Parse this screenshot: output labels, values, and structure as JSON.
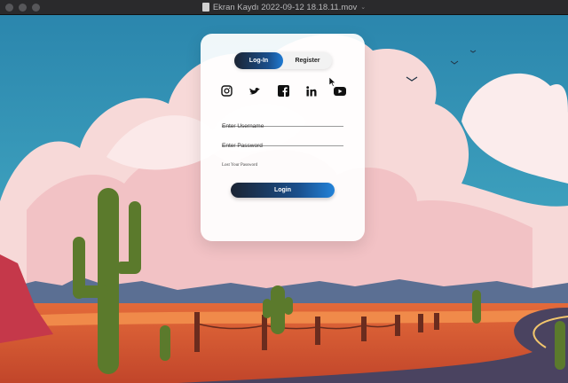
{
  "window": {
    "title": "Ekran Kaydı 2022-09-12 18.18.11.mov"
  },
  "form": {
    "tabs": [
      {
        "label": "Log-In",
        "active": true
      },
      {
        "label": "Register",
        "active": false
      }
    ],
    "social_icons": [
      "instagram-icon",
      "twitter-icon",
      "facebook-icon",
      "linkedin-icon",
      "youtube-icon"
    ],
    "username_placeholder": "Enter Username",
    "password_placeholder": "Enter Password",
    "lost_password": "Lost Your Password",
    "login_button": "Login"
  },
  "colors": {
    "button_gradient_start": "#1b2433",
    "button_gradient_end": "#2383d9",
    "sky": "#2f8fb0"
  }
}
